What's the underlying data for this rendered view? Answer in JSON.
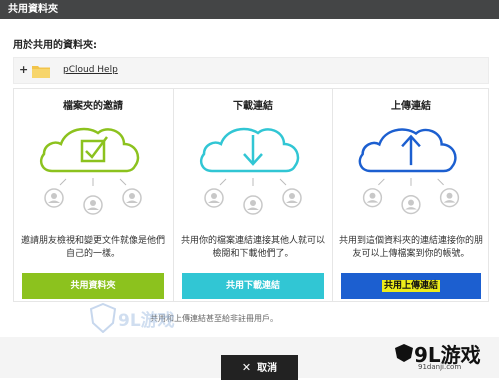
{
  "window": {
    "title": "共用資料夾"
  },
  "dialog": {
    "subtitle": "用於共用的資料夾:",
    "folder": {
      "expand_symbol": "+",
      "name": "pCloud Help"
    }
  },
  "panels": [
    {
      "title": "檔案夾的邀請",
      "description": "邀請朋友檢視和變更文件就像是他們自己的一樣。",
      "button_label": "共用資料夾",
      "icon": "checkbox-cloud-icon",
      "color": "#8cc21e"
    },
    {
      "title": "下載連結",
      "description": "共用你的檔案連結連接其他人就可以檢閱和下載他們了。",
      "button_label": "共用下載連結",
      "icon": "download-cloud-icon",
      "color": "#31c6d4"
    },
    {
      "title": "上傳連結",
      "description": "共用到這個資料夾的連結連接你的朋友可以上傳檔案到你的帳號。",
      "button_label": "共用上傳連結",
      "icon": "upload-cloud-icon",
      "color": "#1c5fd0"
    }
  ],
  "footnote": "共用和上傳連結甚至給非註冊用戶。",
  "footer": {
    "cancel_symbol": "✕",
    "cancel_label": "取消"
  },
  "watermarks": {
    "center_logo": "9L游戏",
    "brand_title": "9L游戏",
    "brand_url": "91danji.com"
  }
}
